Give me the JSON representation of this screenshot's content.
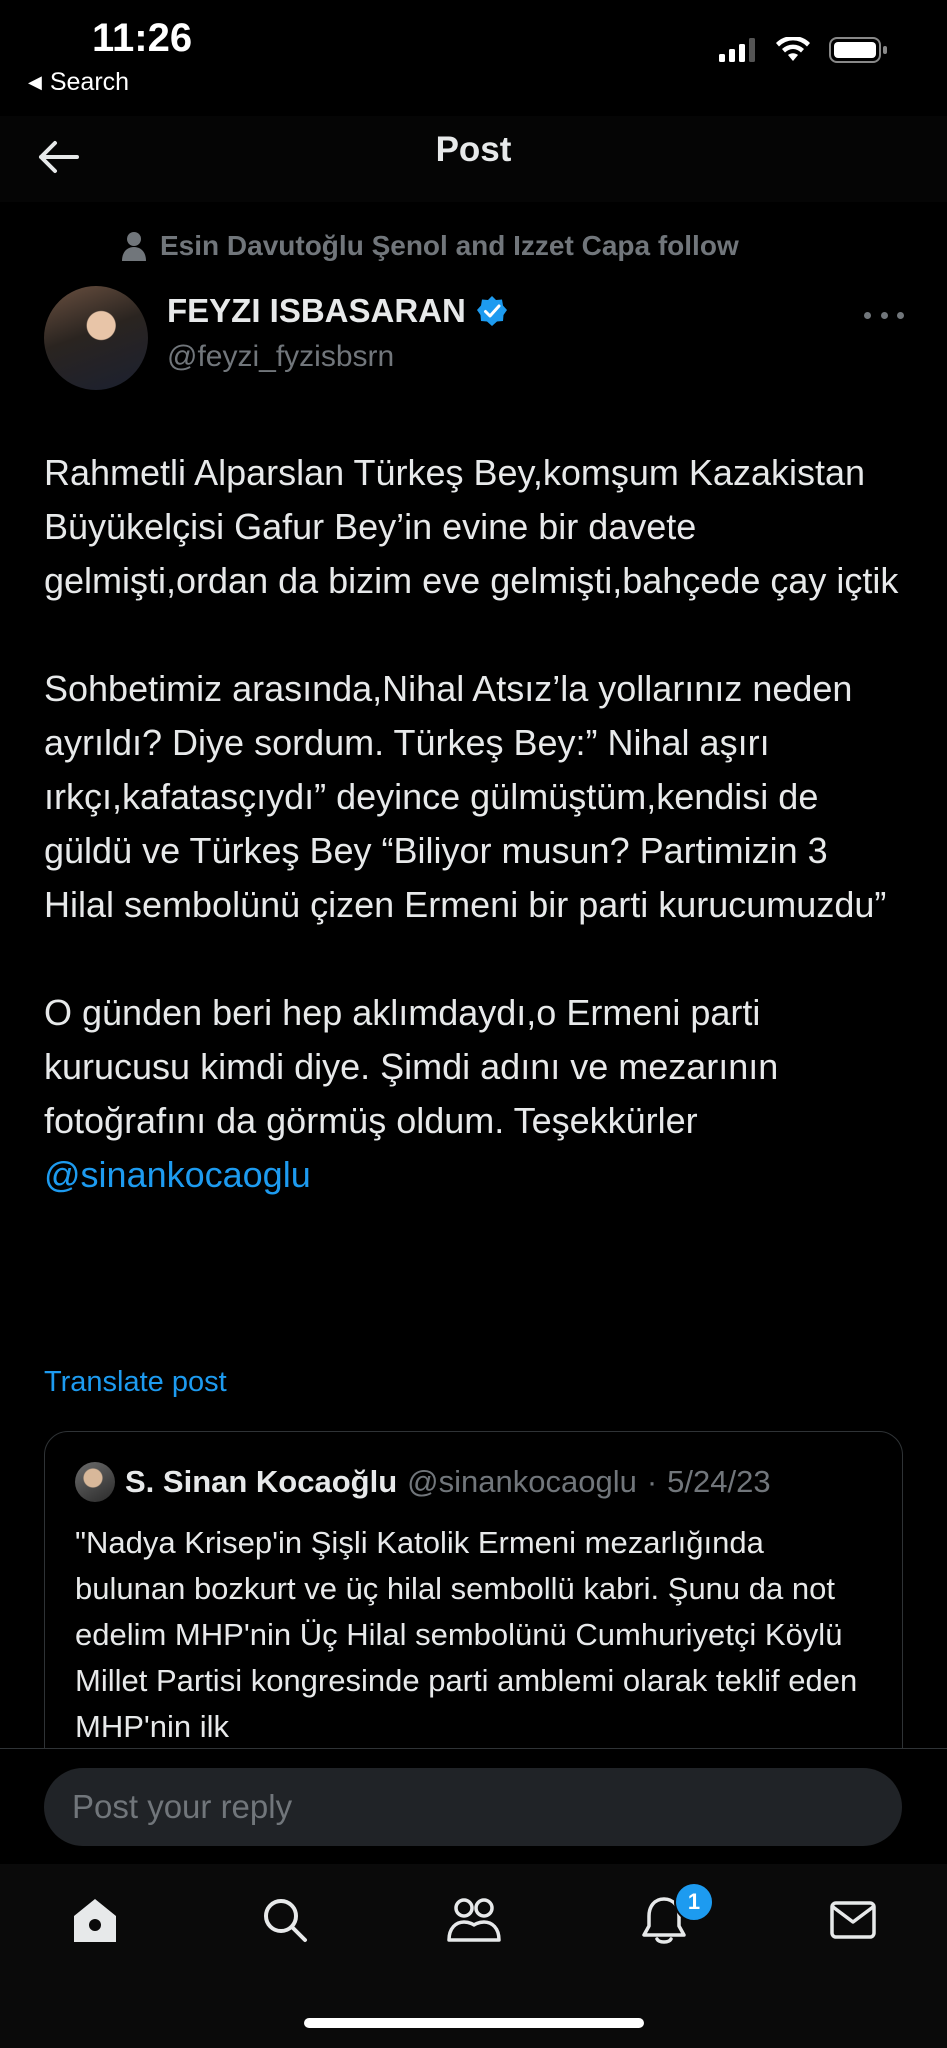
{
  "status_bar": {
    "time": "11:26",
    "back_app": "Search"
  },
  "header": {
    "title": "Post"
  },
  "post": {
    "social_context": "Esin Davutoğlu Şenol and Izzet Capa follow",
    "author_name": "FEYZI ISBASARAN",
    "author_handle": "@feyzi_fyzisbsrn",
    "verified": true,
    "paragraphs": [
      "Rahmetli Alparslan Türkeş Bey,komşum Kazakistan Büyükelçisi Gafur Bey’in evine bir davete gelmişti,ordan da bizim eve gelmişti,bahçede çay içtik",
      "Sohbetimiz arasında,Nihal Atsız’la yollarınız neden ayrıldı? Diye sordum. Türkeş Bey:” Nihal aşırı ırkçı,kafatasçıydı” deyince gülmüştüm,kendisi de güldü ve Türkeş Bey “Biliyor musun? Partimizin 3 Hilal sembolünü çizen Ermeni bir parti kurucumuzdu”",
      "O günden beri hep aklımdaydı,o Ermeni parti kurucusu kimdi diye. Şimdi adını ve mezarının fotoğrafını da görmüş oldum. Teşekkürler"
    ],
    "mention": "@sinankocaoglu",
    "translate_label": "Translate post"
  },
  "quote": {
    "name": "S. Sinan Kocaoğlu",
    "handle": "@sinankocaoglu",
    "separator": "·",
    "date": "5/24/23",
    "text": "\"Nadya Krisep'in Şişli Katolik Ermeni mezarlığında bulunan bozkurt ve üç hilal sembollü kabri. Şunu da not edelim MHP'nin Üç Hilal sembolünü Cumhuriyetçi Köylü Millet Partisi kongresinde parti amblemi olarak teklif eden MHP'nin ilk"
  },
  "reply": {
    "placeholder": "Post your reply"
  },
  "tabbar": {
    "items": [
      "home-icon",
      "search-icon",
      "communities-icon",
      "notifications-icon",
      "messages-icon"
    ],
    "notification_count": "1"
  },
  "colors": {
    "accent": "#1d9bf0",
    "background": "#000000",
    "muted": "#71767b"
  }
}
